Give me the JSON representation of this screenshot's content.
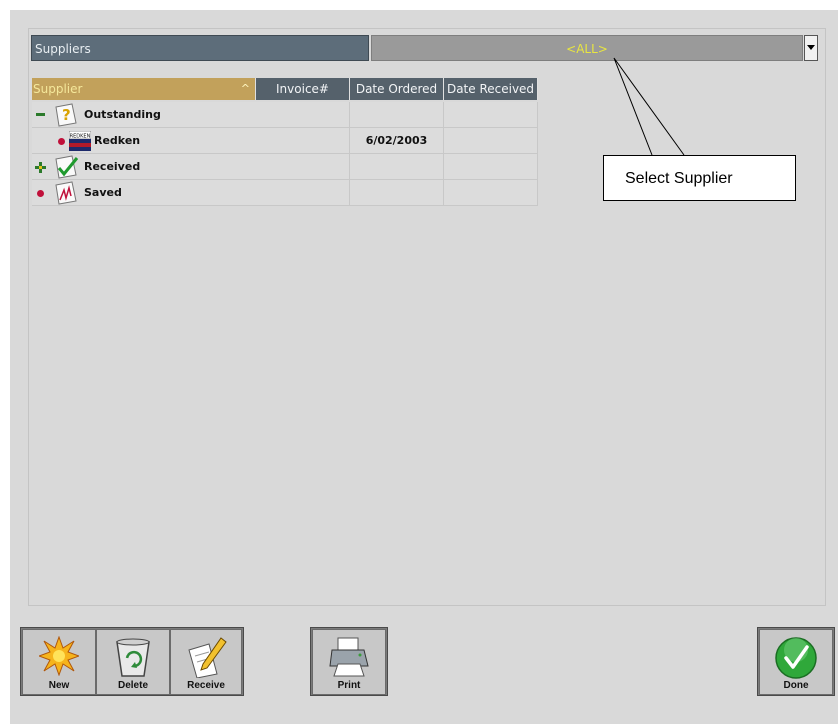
{
  "supplier_filter": {
    "label": "Suppliers",
    "selected": "<ALL>"
  },
  "grid": {
    "columns": [
      "Supplier",
      "Invoice#",
      "Date Ordered",
      "Date Received"
    ],
    "rows": [
      {
        "kind": "group",
        "expander": "−",
        "icon": "question-document-icon",
        "label": "Outstanding",
        "invoice": "",
        "date_ordered": "",
        "date_received": ""
      },
      {
        "kind": "item",
        "bullet": "red-dot",
        "logo_text": "REDKEN",
        "label": "Redken",
        "invoice": "",
        "date_ordered": "6/02/2003",
        "date_received": ""
      },
      {
        "kind": "group",
        "expander": "+",
        "icon": "checkmark-document-icon",
        "label": "Received",
        "invoice": "",
        "date_ordered": "",
        "date_received": ""
      },
      {
        "kind": "group",
        "bullet": "red-dot",
        "icon": "signed-document-icon",
        "label": "Saved",
        "invoice": "",
        "date_ordered": "",
        "date_received": ""
      }
    ]
  },
  "callout": {
    "text": "Select Supplier"
  },
  "toolbar": {
    "new_label": "New",
    "delete_label": "Delete",
    "receive_label": "Receive",
    "print_label": "Print",
    "done_label": "Done"
  },
  "colors": {
    "supplier_header": "#c2a15b",
    "column_header": "#55616b",
    "select_text": "#e8e640",
    "done_green": "#2fa83a"
  }
}
